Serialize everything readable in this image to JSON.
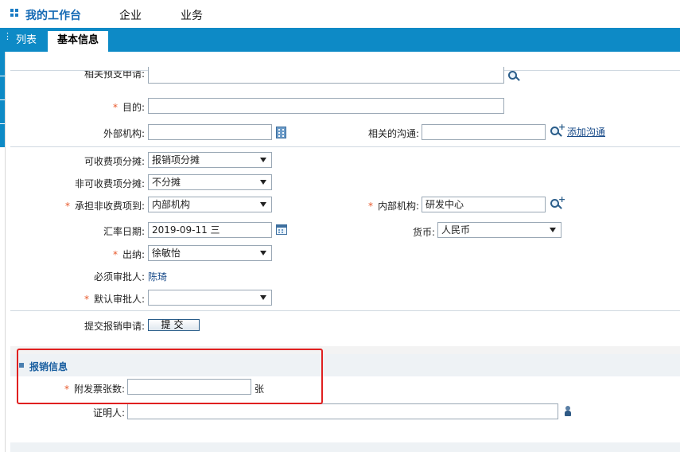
{
  "topbar": {
    "home_label": "我的工作台",
    "menu": [
      "企业",
      "业务"
    ]
  },
  "tabs": [
    "列表",
    "基本信息"
  ],
  "form": {
    "budget_label": "相关预支申请:",
    "purpose_label": "目的:",
    "purpose_value": "",
    "external_org_label": "外部机构:",
    "related_comm_label": "相关的沟通:",
    "add_comm_link": "添加沟通",
    "chargeable_split_label": "可收费项分摊:",
    "chargeable_split_value": "报销项分摊",
    "nonchargeable_split_label": "非可收费项分摊:",
    "nonchargeable_split_value": "不分摊",
    "bear_nonchargeable_label": "承担非收费项到:",
    "bear_nonchargeable_value": "内部机构",
    "internal_org_label": "内部机构:",
    "internal_org_value": "研发中心",
    "rate_date_label": "汇率日期:",
    "rate_date_value": "2019-09-11 三",
    "currency_label": "货币:",
    "currency_value": "人民币",
    "cashier_label": "出纳:",
    "cashier_value": "徐敏怡",
    "required_approver_label": "必须审批人:",
    "required_approver_value": "陈琦",
    "default_approver_label": "默认审批人:",
    "default_approver_value": "",
    "submit_label": "提交报销申请:",
    "submit_button": "提交"
  },
  "reimbursement": {
    "section_title": "报销信息",
    "invoice_count_label": "附发票张数:",
    "invoice_count_value": "",
    "invoice_unit": "张",
    "witness_label": "证明人:",
    "witness_value": ""
  },
  "colors": {
    "tab_blue": "#0d8ac6",
    "required_star": "#e8582a",
    "highlight_box": "#e02020"
  }
}
